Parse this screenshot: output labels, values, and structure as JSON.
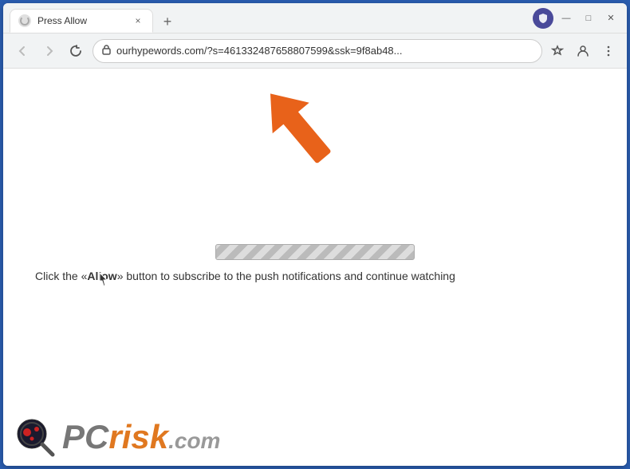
{
  "window": {
    "title": "Press Allow",
    "tab_title": "Press Allow"
  },
  "browser": {
    "url": "ourhypewords.com/?s=461332487658807599&ssk=9f8ab48...",
    "url_short": "ourhypewords.com/?s=461332487658807599&ssk=9f8ab48...",
    "tab_close_label": "×",
    "tab_new_label": "+",
    "nav_back": "←",
    "nav_forward": "→",
    "nav_close": "✕",
    "lock_symbol": "🔒",
    "star_symbol": "☆",
    "person_symbol": "👤",
    "menu_symbol": "⋮",
    "shield_symbol": "🛡"
  },
  "content": {
    "instruction": "Click the «Allow» button to subscribe to the push notifications and continue watching",
    "instruction_prefix": "Click the «",
    "instruction_allow": "Allow",
    "instruction_suffix": "» button to subscribe to the push notifications and continue watching"
  },
  "pcrisk": {
    "text_pc": "PC",
    "text_risk": "risk",
    "text_dotcom": ".com"
  },
  "window_controls": {
    "minimize": "—",
    "maximize": "□",
    "close": "✕"
  }
}
